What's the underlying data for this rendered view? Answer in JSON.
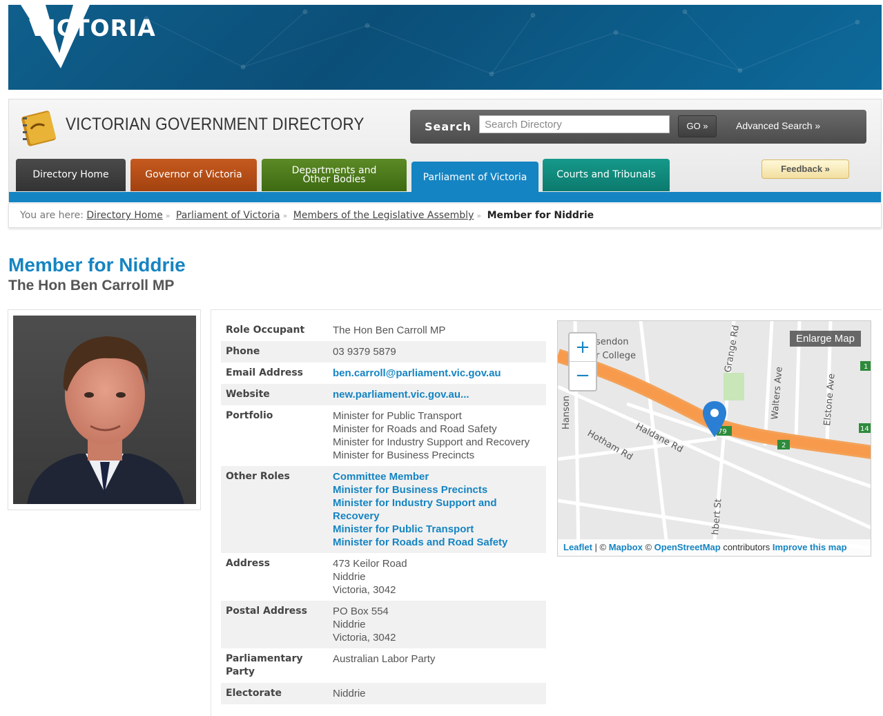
{
  "banner": {
    "logo_text": "VICTORIA"
  },
  "header": {
    "title": "VICTORIAN GOVERNMENT DIRECTORY",
    "search_label": "Search",
    "search_placeholder": "Search Directory",
    "go_label": "GO »",
    "advanced_search": "Advanced Search »",
    "feedback": "Feedback »"
  },
  "tabs": [
    {
      "label": "Directory Home"
    },
    {
      "label": "Governor of Victoria"
    },
    {
      "label_line1": "Departments and",
      "label_line2": "Other Bodies"
    },
    {
      "label": "Parliament of Victoria"
    },
    {
      "label": "Courts and Tribunals"
    }
  ],
  "breadcrumb": {
    "prefix": "You are here:",
    "items": [
      "Directory Home",
      "Parliament of Victoria",
      "Members of the Legislative Assembly"
    ],
    "current": "Member for Niddrie"
  },
  "page": {
    "title": "Member for Niddrie",
    "subtitle": "The Hon Ben Carroll MP"
  },
  "details": {
    "role_occupant": {
      "label": "Role Occupant",
      "value": "The Hon Ben Carroll MP"
    },
    "phone": {
      "label": "Phone",
      "value": "03 9379 5879"
    },
    "email": {
      "label": "Email Address",
      "value": "ben.carroll@parliament.vic.gov.au"
    },
    "website": {
      "label": "Website",
      "value": "new.parliament.vic.gov.au..."
    },
    "portfolio": {
      "label": "Portfolio",
      "lines": [
        "Minister for Public Transport",
        "Minister for Roads and Road Safety",
        "Minister for Industry Support and Recovery",
        "Minister for Business Precincts"
      ]
    },
    "other_roles": {
      "label": "Other Roles",
      "links": [
        "Committee Member",
        "Minister for Business Precincts",
        "Minister for Industry Support and",
        "Recovery",
        "Minister for Public Transport",
        "Minister for Roads and Road Safety"
      ]
    },
    "address": {
      "label": "Address",
      "lines": [
        "473 Keilor Road",
        "Niddrie",
        "Victoria, 3042"
      ]
    },
    "postal_address": {
      "label": "Postal Address",
      "lines": [
        "PO Box 554",
        "Niddrie",
        "Victoria, 3042"
      ]
    },
    "party": {
      "label": "Parliamentary Party",
      "value": "Australian Labor Party"
    },
    "electorate": {
      "label": "Electorate",
      "value": "Niddrie"
    }
  },
  "map": {
    "enlarge": "Enlarge Map",
    "zoom_in": "+",
    "zoom_out": "−",
    "labels": {
      "college1": "sendon",
      "college2": "r College",
      "grange": "Grange Rd",
      "walters": "Walters Ave",
      "elstone": "Elstone Ave",
      "hanson": "Hanson",
      "hotham": "Hotham Rd",
      "haldane": "Haldane Rd",
      "hbert": "hbert St",
      "shield_79": "79",
      "shield_2": "2",
      "shield_14": "14",
      "shield_1": "1"
    },
    "attribution": {
      "leaflet": "Leaflet",
      "sep": " | © ",
      "mapbox": "Mapbox",
      "osm_prefix": " © ",
      "osm": "OpenStreetMap",
      "contrib": " contributors ",
      "improve": "Improve this map"
    }
  }
}
